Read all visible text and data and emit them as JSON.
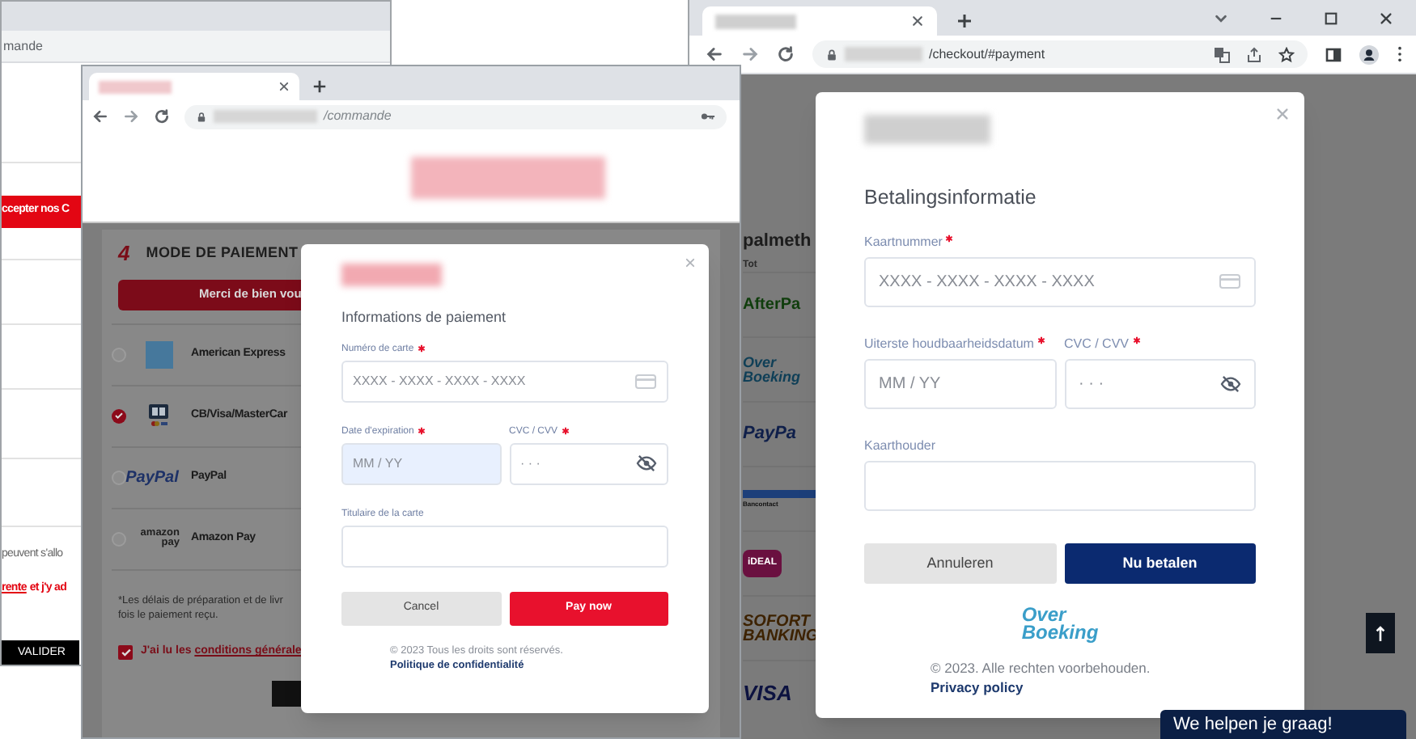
{
  "back_window": {
    "url": "mande",
    "banner": "ccepter nos C",
    "note": "peuvent s'allo",
    "terms_link": "rente",
    "terms_text": "et j'y ad",
    "submit_button": "VALIDER"
  },
  "commande_window": {
    "url": "/commande",
    "section_number": "4",
    "section_title": "MODE DE PAIEMENT",
    "notice_button": "Merci de bien vou",
    "payment_methods": [
      {
        "kind": "amex",
        "label": "American Express",
        "selected": false
      },
      {
        "kind": "cb",
        "label": "CB/Visa/MasterCar",
        "selected": true
      },
      {
        "kind": "paypal",
        "logo_text": "PayPal",
        "label": "PayPal",
        "selected": false
      },
      {
        "kind": "amazon",
        "logo_text": "amazon pay",
        "label": "Amazon Pay",
        "selected": false
      }
    ],
    "delivery_note": [
      "*Les délais de préparation et de livr",
      "fois le paiement reçu."
    ],
    "terms": {
      "checked": true,
      "text": "J'ai lu les",
      "link": "conditions générale"
    },
    "modal": {
      "title": "Informations de paiement",
      "card_number": {
        "label": "Numéro de carte",
        "required": true,
        "placeholder": "XXXX - XXXX - XXXX - XXXX",
        "highlighted": false
      },
      "expiry": {
        "label": "Date d'expiration",
        "required": true,
        "placeholder": "MM / YY",
        "highlighted": true
      },
      "cvc": {
        "label": "CVC / CVV",
        "required": true,
        "placeholder": "· · ·",
        "highlighted": false
      },
      "holder": {
        "label": "Titulaire de la carte",
        "required": false,
        "highlighted": false
      },
      "cancel_button": "Cancel",
      "pay_button": "Pay now",
      "footer": "© 2023 Tous les droits sont réservés.",
      "footer_link": "Politique de confidentialité"
    }
  },
  "checkout_window": {
    "url": "/checkout/#payment",
    "heading": "palmeth",
    "total_label": "Tot",
    "methods": [
      {
        "kind": "afterpay",
        "lines": [
          "AfterPa"
        ]
      },
      {
        "kind": "overboeking",
        "lines": [
          "Over",
          "Boeking"
        ]
      },
      {
        "kind": "paypal",
        "lines": [
          "PayPa"
        ]
      },
      {
        "kind": "bancontact",
        "lines": [
          "Bancontact"
        ]
      },
      {
        "kind": "ideal",
        "lines": [
          "iDEAL"
        ]
      },
      {
        "kind": "sofort",
        "lines": [
          "SOFORT",
          "BANKING"
        ]
      },
      {
        "kind": "visa",
        "lines": [
          "VISA"
        ]
      }
    ],
    "modal": {
      "title": "Betalingsinformatie",
      "card_number": {
        "label": "Kaartnummer",
        "required": true,
        "placeholder": "XXXX - XXXX - XXXX - XXXX",
        "highlighted": false
      },
      "expiry": {
        "label": "Uiterste houdbaarheidsdatum",
        "required": true,
        "placeholder": "MM / YY",
        "highlighted": false
      },
      "cvc": {
        "label": "CVC / CVV",
        "required": true,
        "placeholder": "· · ·",
        "highlighted": false
      },
      "holder": {
        "label": "Kaarthouder",
        "required": false,
        "highlighted": false
      },
      "cancel_button": "Annuleren",
      "pay_button": "Nu betalen",
      "brand_logo": [
        "Over",
        "Boeking"
      ],
      "footer": "© 2023. Alle rechten voorbehouden.",
      "footer_link": "Privacy policy"
    },
    "chat_label": "We helpen je graag!"
  }
}
